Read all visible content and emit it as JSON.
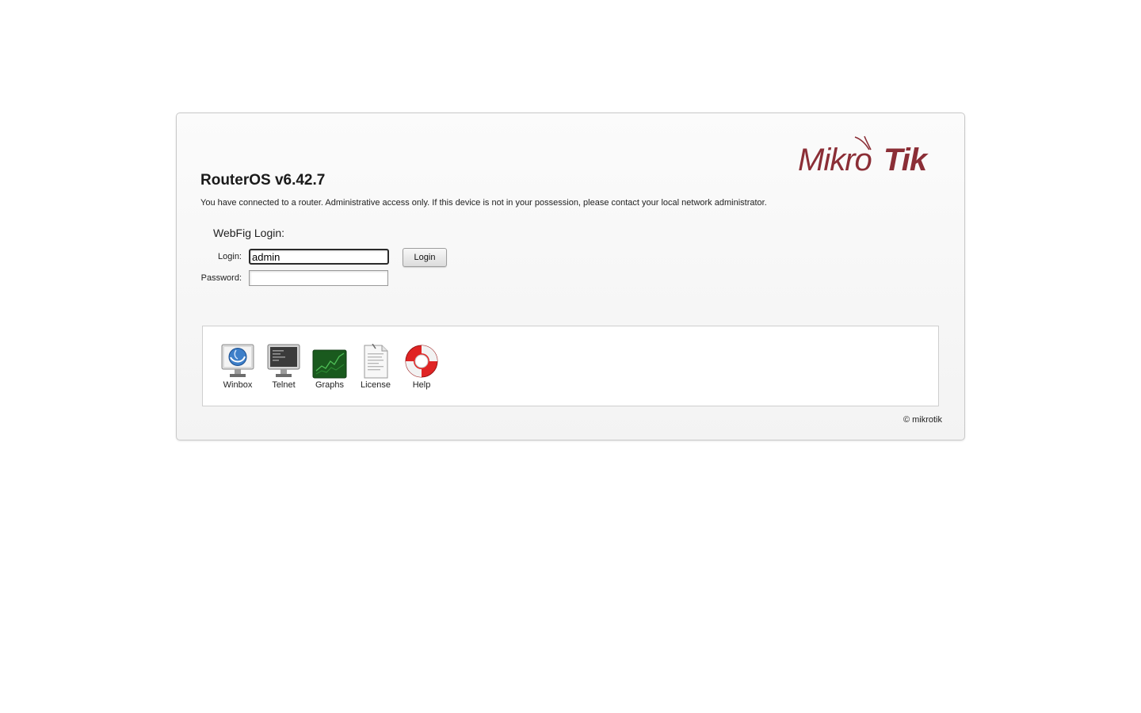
{
  "header": {
    "title": "RouterOS v6.42.7",
    "notice": "You have connected to a router. Administrative access only. If this device is not in your possession, please contact your local network administrator.",
    "logo_text": "MikroTik"
  },
  "login_form": {
    "heading": "WebFig Login:",
    "login_label": "Login:",
    "login_value": "admin",
    "password_label": "Password:",
    "password_value": "",
    "submit_label": "Login"
  },
  "tools": [
    {
      "label": "Winbox",
      "icon": "winbox-icon"
    },
    {
      "label": "Telnet",
      "icon": "telnet-icon"
    },
    {
      "label": "Graphs",
      "icon": "graphs-icon"
    },
    {
      "label": "License",
      "icon": "license-icon"
    },
    {
      "label": "Help",
      "icon": "help-icon"
    }
  ],
  "footer": {
    "copyright": "© mikrotik"
  },
  "colors": {
    "brand": "#8b2e36",
    "panel_border": "#c9c9c9"
  }
}
